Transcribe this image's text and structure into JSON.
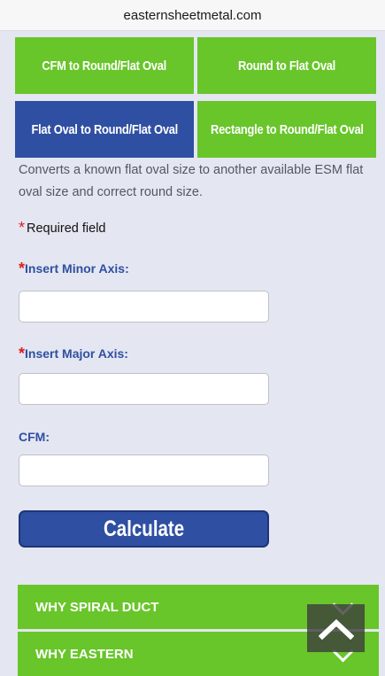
{
  "browser": {
    "url": "easternsheetmetal.com"
  },
  "tabs": [
    {
      "label": "CFM to Round/Flat Oval",
      "active": false
    },
    {
      "label": "Round to Flat Oval",
      "active": false
    },
    {
      "label": "Flat Oval to Round/Flat Oval",
      "active": true
    },
    {
      "label": "Rectangle to Round/Flat Oval",
      "active": false
    }
  ],
  "description": "Converts a known flat oval size to another available ESM flat oval size and correct round size.",
  "required_note": {
    "star": "*",
    "text": "Required field"
  },
  "fields": {
    "minor_axis": {
      "star": "*",
      "label": "Insert Minor Axis:",
      "value": ""
    },
    "major_axis": {
      "star": "*",
      "label": "Insert Major Axis:",
      "value": ""
    },
    "cfm": {
      "label": "CFM:",
      "value": ""
    }
  },
  "calculate_label": "Calculate",
  "accordion": [
    {
      "label": "WHY SPIRAL DUCT",
      "icon": "chevron-down-icon"
    },
    {
      "label": "WHY EASTERN",
      "icon": "chevron-down-icon"
    }
  ],
  "scroll_top_icon": "chevron-up-icon",
  "colors": {
    "green": "#68c52a",
    "blue": "#2f4fa2",
    "background": "#e4e6f1",
    "required_star": "#e11b1b"
  }
}
